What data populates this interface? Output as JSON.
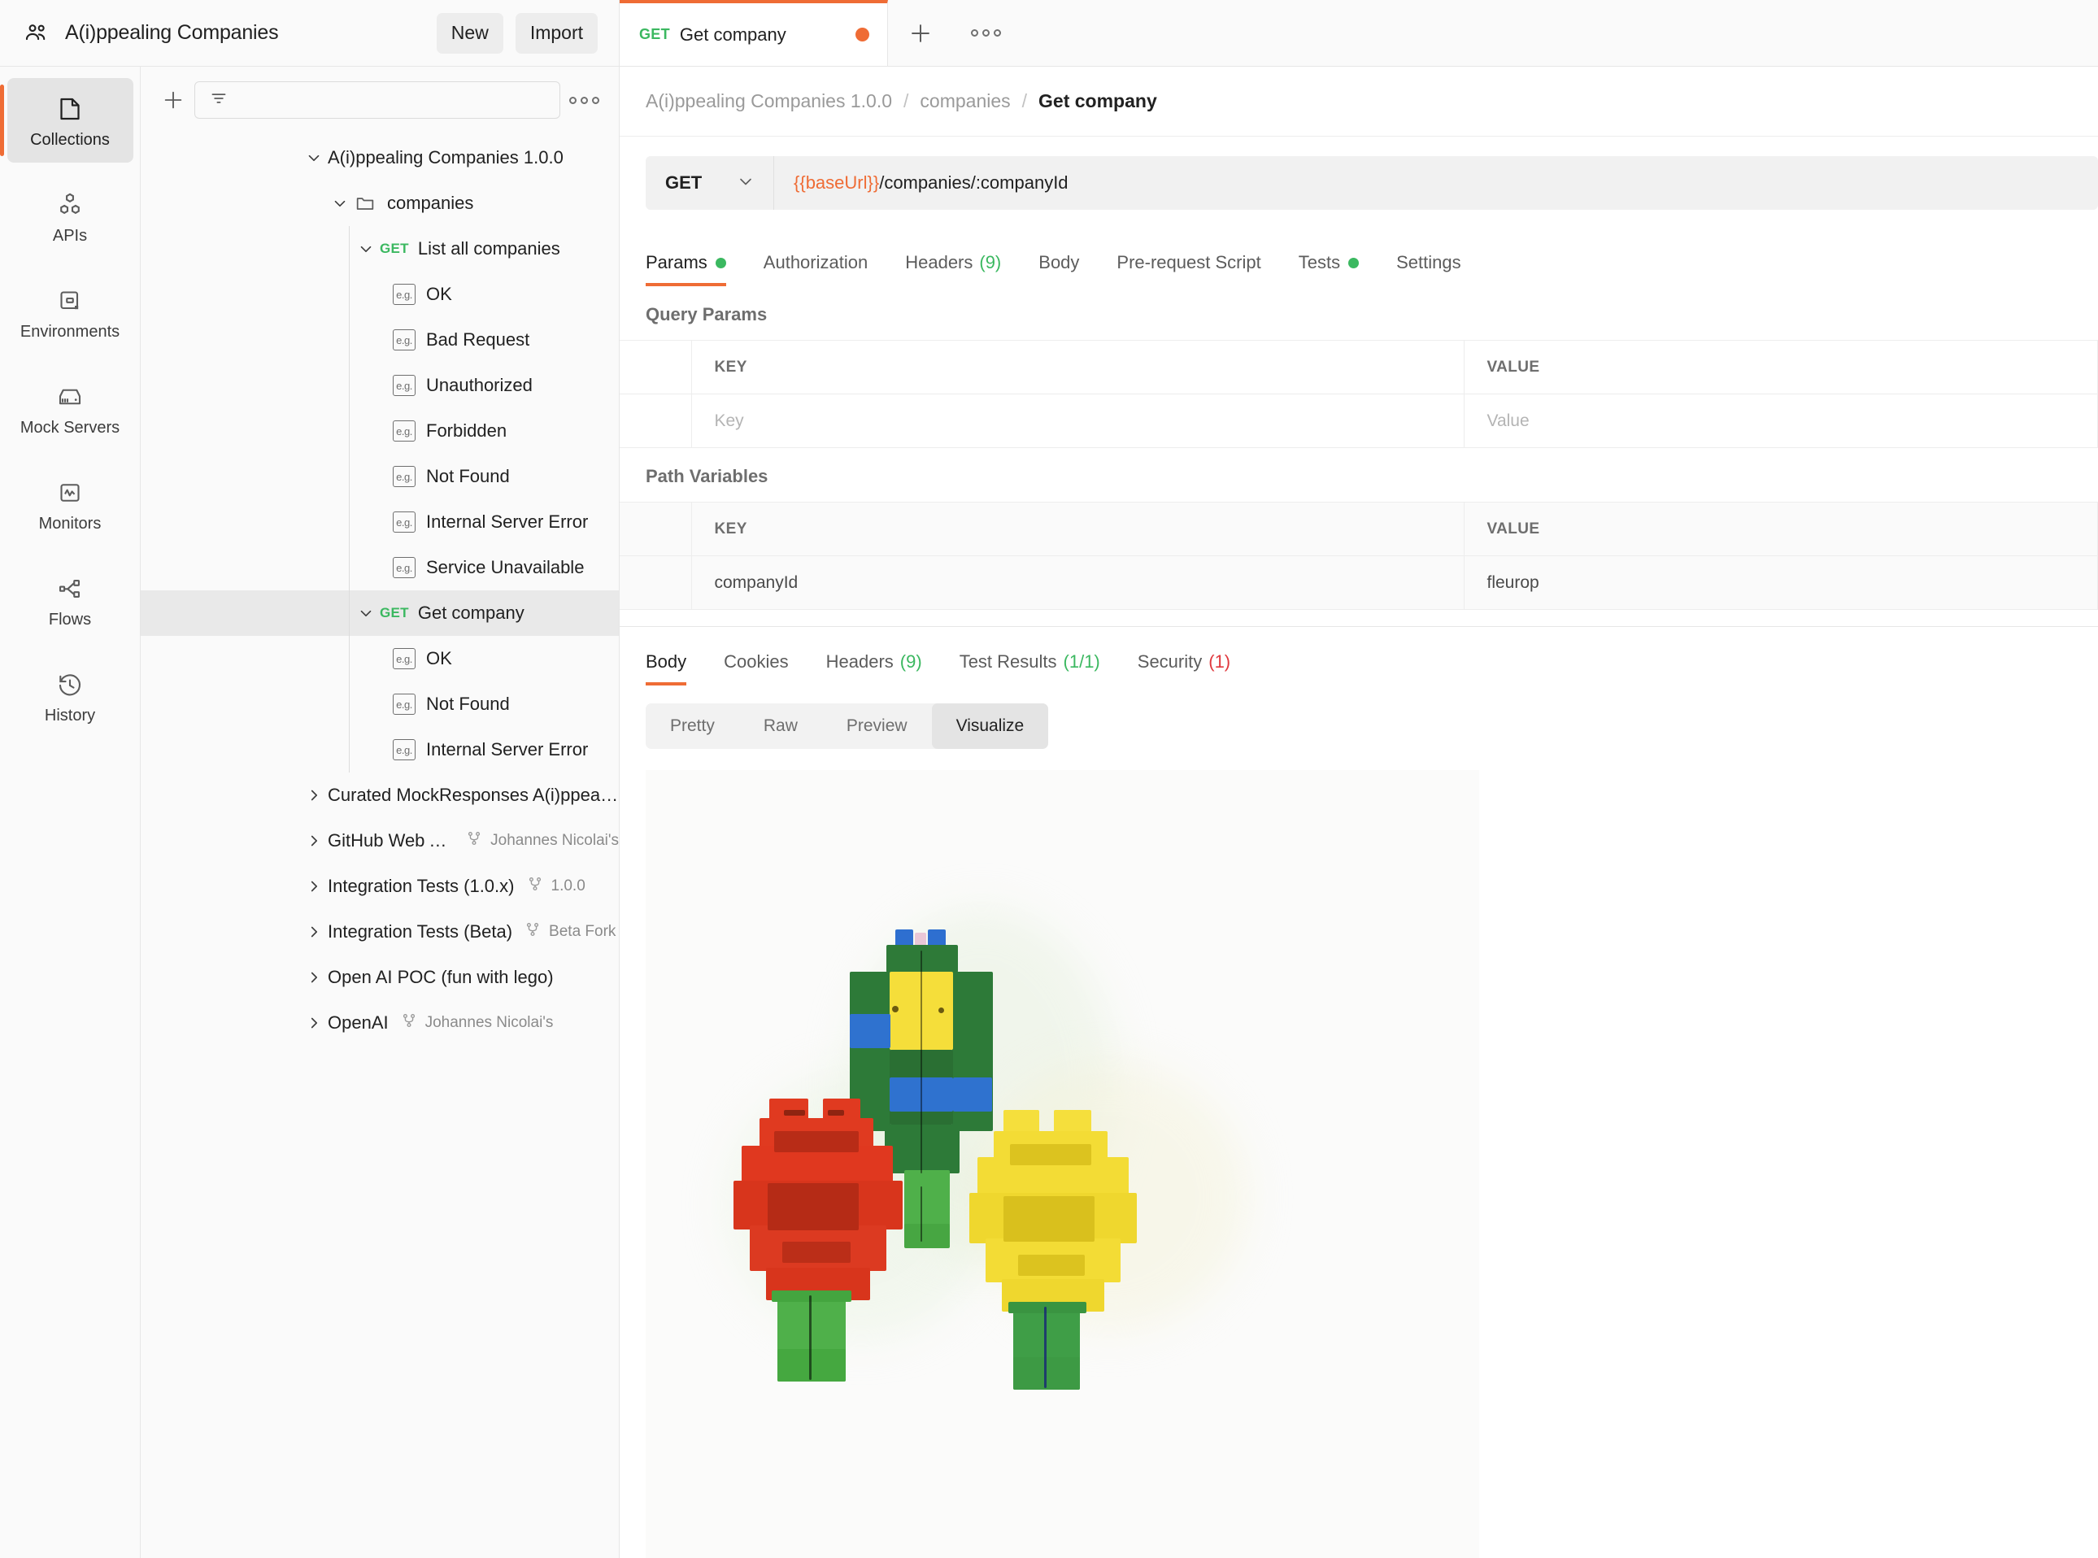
{
  "workspace": {
    "team_icon": "people-icon",
    "title": "A(i)ppealing Companies",
    "new_label": "New",
    "import_label": "Import"
  },
  "tabstrip": {
    "tabs": [
      {
        "method": "GET",
        "label": "Get company",
        "unsaved": true
      }
    ],
    "new_tab_icon": "plus-icon",
    "more_icon": "ellipsis-icon"
  },
  "rail": {
    "items": [
      {
        "label": "Collections",
        "icon": "collections-icon",
        "active": true
      },
      {
        "label": "APIs",
        "icon": "apis-icon",
        "active": false
      },
      {
        "label": "Environments",
        "icon": "environments-icon",
        "active": false
      },
      {
        "label": "Mock Servers",
        "icon": "mock-servers-icon",
        "active": false
      },
      {
        "label": "Monitors",
        "icon": "monitors-icon",
        "active": false
      },
      {
        "label": "Flows",
        "icon": "flows-icon",
        "active": false
      },
      {
        "label": "History",
        "icon": "history-icon",
        "active": false
      }
    ]
  },
  "sidebar": {
    "add_icon": "plus-icon",
    "filter_icon": "filter-icon",
    "filter_placeholder": "",
    "more_icon": "ellipsis-icon",
    "tree": [
      {
        "label": "A(i)ppealing Companies 1.0.0",
        "type": "collection",
        "depth": 0,
        "twisty": "down"
      },
      {
        "label": "companies",
        "type": "folder",
        "depth": 1,
        "twisty": "down"
      },
      {
        "label": "List all companies",
        "type": "request",
        "method": "GET",
        "depth": 2,
        "twisty": "down"
      },
      {
        "label": "OK",
        "type": "example",
        "depth": 3
      },
      {
        "label": "Bad Request",
        "type": "example",
        "depth": 3
      },
      {
        "label": "Unauthorized",
        "type": "example",
        "depth": 3
      },
      {
        "label": "Forbidden",
        "type": "example",
        "depth": 3
      },
      {
        "label": "Not Found",
        "type": "example",
        "depth": 3
      },
      {
        "label": "Internal Server Error",
        "type": "example",
        "depth": 3
      },
      {
        "label": "Service Unavailable",
        "type": "example",
        "depth": 3
      },
      {
        "label": "Get company",
        "type": "request",
        "method": "GET",
        "depth": 2,
        "twisty": "down",
        "selected": true
      },
      {
        "label": "OK",
        "type": "example",
        "depth": 3
      },
      {
        "label": "Not Found",
        "type": "example",
        "depth": 3
      },
      {
        "label": "Internal Server Error",
        "type": "example",
        "depth": 3
      },
      {
        "label": "Curated MockResponses A(i)ppealin...",
        "type": "collection",
        "depth": 0,
        "twisty": "right"
      },
      {
        "label": "GitHub Web API ...",
        "type": "collection",
        "depth": 0,
        "twisty": "right",
        "fork": "Johannes Nicolai's"
      },
      {
        "label": "Integration Tests (1.0.x)",
        "type": "collection",
        "depth": 0,
        "twisty": "right",
        "fork": "1.0.0"
      },
      {
        "label": "Integration Tests (Beta)",
        "type": "collection",
        "depth": 0,
        "twisty": "right",
        "fork": "Beta Fork"
      },
      {
        "label": "Open AI POC (fun with lego)",
        "type": "collection",
        "depth": 0,
        "twisty": "right"
      },
      {
        "label": "OpenAI",
        "type": "collection",
        "depth": 0,
        "twisty": "right",
        "fork": "Johannes Nicolai's"
      }
    ]
  },
  "main": {
    "breadcrumb": [
      {
        "label": "A(i)ppealing Companies 1.0.0",
        "current": false
      },
      {
        "label": "companies",
        "current": false
      },
      {
        "label": "Get company",
        "current": true
      }
    ],
    "breadcrumb_separator": "/",
    "request": {
      "method": "GET",
      "method_chevron": "chevron-down-icon",
      "url_variable": "{{baseUrl}}",
      "url_path": "/companies/:companyId"
    },
    "request_tabs": [
      {
        "label": "Params",
        "active": true,
        "dot": "green"
      },
      {
        "label": "Authorization",
        "active": false
      },
      {
        "label": "Headers",
        "active": false,
        "count": "(9)",
        "count_color": "green"
      },
      {
        "label": "Body",
        "active": false
      },
      {
        "label": "Pre-request Script",
        "active": false
      },
      {
        "label": "Tests",
        "active": false,
        "dot": "green"
      },
      {
        "label": "Settings",
        "active": false
      }
    ],
    "query_params": {
      "title": "Query Params",
      "headers": [
        "",
        "KEY",
        "VALUE"
      ],
      "rows": [
        {
          "key": "",
          "key_placeholder": "Key",
          "value": "",
          "value_placeholder": "Value"
        }
      ]
    },
    "path_variables": {
      "title": "Path Variables",
      "headers": [
        "",
        "KEY",
        "VALUE"
      ],
      "rows": [
        {
          "key": "companyId",
          "value": "fleurop"
        }
      ]
    },
    "response_tabs": [
      {
        "label": "Body",
        "active": true
      },
      {
        "label": "Cookies",
        "active": false
      },
      {
        "label": "Headers",
        "active": false,
        "count": "(9)",
        "count_color": "green"
      },
      {
        "label": "Test Results",
        "active": false,
        "count": "(1/1)",
        "count_color": "green"
      },
      {
        "label": "Security",
        "active": false,
        "count": "(1)",
        "count_color": "red"
      }
    ],
    "view_modes": [
      {
        "label": "Pretty",
        "active": false
      },
      {
        "label": "Raw",
        "active": false
      },
      {
        "label": "Preview",
        "active": false
      },
      {
        "label": "Visualize",
        "active": true
      }
    ],
    "visualization": {
      "alt": "Photo of three LEGO brick flowers: a red flower, a tall green stem with yellow and blue bricks, and a yellow flower, on a white background"
    }
  },
  "colors": {
    "accent": "#ef6c35",
    "method_get": "#3bb860",
    "success": "#3bb860",
    "danger": "#e0393e",
    "text": "#212121",
    "muted": "#6e6e6e"
  }
}
